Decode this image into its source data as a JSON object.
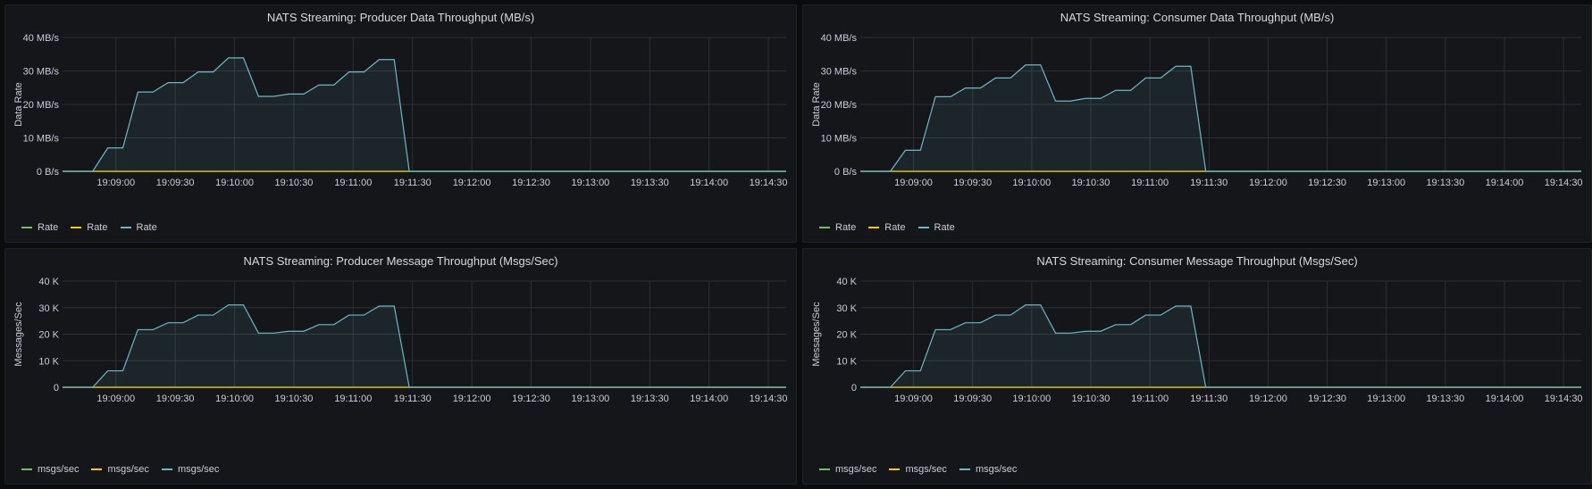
{
  "chart_data": [
    {
      "type": "line",
      "title": "NATS Streaming: Producer Data Throughput (MB/s)",
      "ylabel": "Data Rate",
      "ylim": [
        0,
        40
      ],
      "yticks": [
        0,
        10,
        20,
        30,
        40
      ],
      "ytick_labels": [
        "0 B/s",
        "10 MB/s",
        "20 MB/s",
        "30 MB/s",
        "40 MB/s"
      ],
      "xticks": [
        "19:09:00",
        "19:09:30",
        "19:10:00",
        "19:10:30",
        "19:11:00",
        "19:11:30",
        "19:12:00",
        "19:12:30",
        "19:13:00",
        "19:13:30",
        "19:14:00",
        "19:14:30"
      ],
      "xlim": [
        0,
        720
      ],
      "grid": true,
      "legend_position": "bottom-left",
      "series": [
        {
          "name": "Rate",
          "color": "#73bf69",
          "x": [
            0,
            720
          ],
          "values": [
            0,
            0
          ]
        },
        {
          "name": "Rate",
          "color": "#f2cc0c",
          "x": [
            0,
            720
          ],
          "values": [
            0,
            0
          ]
        },
        {
          "name": "Rate",
          "color": "#6cb8c4",
          "fill": true,
          "x": [
            0,
            15,
            30,
            45,
            60,
            75,
            90,
            105,
            120,
            135,
            150,
            165,
            180,
            195,
            210,
            225,
            240,
            255,
            270,
            285,
            300,
            315,
            330,
            345,
            360,
            375,
            390,
            405,
            420,
            435,
            450,
            465,
            480,
            495,
            510,
            525,
            540,
            555,
            570,
            585,
            600,
            615,
            630,
            645,
            660,
            675,
            690,
            705,
            720
          ],
          "values": [
            0,
            0,
            0,
            7,
            7,
            23.7,
            23.7,
            26.5,
            26.5,
            29.7,
            29.7,
            33.9,
            33.9,
            22.4,
            22.4,
            23.1,
            23.1,
            25.8,
            25.8,
            29.7,
            29.7,
            33.4,
            33.4,
            0,
            0,
            0,
            0,
            0,
            0,
            0,
            0,
            0,
            0,
            0,
            0,
            0,
            0,
            0,
            0,
            0,
            0,
            0,
            0,
            0,
            0,
            0,
            0,
            0,
            0
          ]
        }
      ]
    },
    {
      "type": "line",
      "title": "NATS Streaming: Consumer Data Throughput (MB/s)",
      "ylabel": "Data Rate",
      "ylim": [
        0,
        40
      ],
      "yticks": [
        0,
        10,
        20,
        30,
        40
      ],
      "ytick_labels": [
        "0 B/s",
        "10 MB/s",
        "20 MB/s",
        "30 MB/s",
        "40 MB/s"
      ],
      "xticks": [
        "19:09:00",
        "19:09:30",
        "19:10:00",
        "19:10:30",
        "19:11:00",
        "19:11:30",
        "19:12:00",
        "19:12:30",
        "19:13:00",
        "19:13:30",
        "19:14:00",
        "19:14:30"
      ],
      "xlim": [
        0,
        720
      ],
      "grid": true,
      "legend_position": "bottom-left",
      "series": [
        {
          "name": "Rate",
          "color": "#73bf69",
          "x": [
            0,
            720
          ],
          "values": [
            0,
            0
          ]
        },
        {
          "name": "Rate",
          "color": "#f2cc0c",
          "x": [
            0,
            720
          ],
          "values": [
            0,
            0
          ]
        },
        {
          "name": "Rate",
          "color": "#6cb8c4",
          "fill": true,
          "x": [
            0,
            15,
            30,
            45,
            60,
            75,
            90,
            105,
            120,
            135,
            150,
            165,
            180,
            195,
            210,
            225,
            240,
            255,
            270,
            285,
            300,
            315,
            330,
            345,
            360,
            375,
            390,
            405,
            420,
            435,
            450,
            465,
            480,
            495,
            510,
            525,
            540,
            555,
            570,
            585,
            600,
            615,
            630,
            645,
            660,
            675,
            690,
            705,
            720
          ],
          "values": [
            0,
            0,
            0,
            6.3,
            6.3,
            22.3,
            22.3,
            24.9,
            24.9,
            27.9,
            27.9,
            31.8,
            31.8,
            21,
            21,
            21.8,
            21.8,
            24.2,
            24.2,
            27.9,
            27.9,
            31.4,
            31.4,
            0,
            0,
            0,
            0,
            0,
            0,
            0,
            0,
            0,
            0,
            0,
            0,
            0,
            0,
            0,
            0,
            0,
            0,
            0,
            0,
            0,
            0,
            0,
            0,
            0,
            0
          ]
        }
      ]
    },
    {
      "type": "line",
      "title": "NATS Streaming: Producer Message Throughput (Msgs/Sec)",
      "ylabel": "Messages/Sec",
      "ylim": [
        0,
        40000
      ],
      "yticks": [
        0,
        10000,
        20000,
        30000,
        40000
      ],
      "ytick_labels": [
        "0",
        "10 K",
        "20 K",
        "30 K",
        "40 K"
      ],
      "xticks": [
        "19:09:00",
        "19:09:30",
        "19:10:00",
        "19:10:30",
        "19:11:00",
        "19:11:30",
        "19:12:00",
        "19:12:30",
        "19:13:00",
        "19:13:30",
        "19:14:00",
        "19:14:30"
      ],
      "xlim": [
        0,
        720
      ],
      "grid": true,
      "legend_position": "bottom-left",
      "series": [
        {
          "name": "msgs/sec",
          "color": "#73bf69",
          "x": [
            0,
            720
          ],
          "values": [
            0,
            0
          ]
        },
        {
          "name": "msgs/sec",
          "color": "#f2cc0c",
          "x": [
            0,
            720
          ],
          "values": [
            0,
            0
          ]
        },
        {
          "name": "msgs/sec",
          "color": "#6cb8c4",
          "fill": true,
          "x": [
            0,
            15,
            30,
            45,
            60,
            75,
            90,
            105,
            120,
            135,
            150,
            165,
            180,
            195,
            210,
            225,
            240,
            255,
            270,
            285,
            300,
            315,
            330,
            345,
            360,
            375,
            390,
            405,
            420,
            435,
            450,
            465,
            480,
            495,
            510,
            525,
            540,
            555,
            570,
            585,
            600,
            615,
            630,
            645,
            660,
            675,
            690,
            705,
            720
          ],
          "values": [
            0,
            0,
            0,
            6200,
            6200,
            21700,
            21700,
            24300,
            24300,
            27200,
            27200,
            31000,
            31000,
            20400,
            20400,
            21100,
            21100,
            23600,
            23600,
            27200,
            27200,
            30600,
            30600,
            0,
            0,
            0,
            0,
            0,
            0,
            0,
            0,
            0,
            0,
            0,
            0,
            0,
            0,
            0,
            0,
            0,
            0,
            0,
            0,
            0,
            0,
            0,
            0,
            0,
            0
          ]
        }
      ]
    },
    {
      "type": "line",
      "title": "NATS Streaming: Consumer Message Throughput (Msgs/Sec)",
      "ylabel": "Messages/Sec",
      "ylim": [
        0,
        40000
      ],
      "yticks": [
        0,
        10000,
        20000,
        30000,
        40000
      ],
      "ytick_labels": [
        "0",
        "10 K",
        "20 K",
        "30 K",
        "40 K"
      ],
      "xticks": [
        "19:09:00",
        "19:09:30",
        "19:10:00",
        "19:10:30",
        "19:11:00",
        "19:11:30",
        "19:12:00",
        "19:12:30",
        "19:13:00",
        "19:13:30",
        "19:14:00",
        "19:14:30"
      ],
      "xlim": [
        0,
        720
      ],
      "grid": true,
      "legend_position": "bottom-left",
      "series": [
        {
          "name": "msgs/sec",
          "color": "#73bf69",
          "x": [
            0,
            720
          ],
          "values": [
            0,
            0
          ]
        },
        {
          "name": "msgs/sec",
          "color": "#f2cc0c",
          "x": [
            0,
            720
          ],
          "values": [
            0,
            0
          ]
        },
        {
          "name": "msgs/sec",
          "color": "#6cb8c4",
          "fill": true,
          "x": [
            0,
            15,
            30,
            45,
            60,
            75,
            90,
            105,
            120,
            135,
            150,
            165,
            180,
            195,
            210,
            225,
            240,
            255,
            270,
            285,
            300,
            315,
            330,
            345,
            360,
            375,
            390,
            405,
            420,
            435,
            450,
            465,
            480,
            495,
            510,
            525,
            540,
            555,
            570,
            585,
            600,
            615,
            630,
            645,
            660,
            675,
            690,
            705,
            720
          ],
          "values": [
            0,
            0,
            0,
            6200,
            6200,
            21700,
            21700,
            24300,
            24300,
            27200,
            27200,
            31000,
            31000,
            20400,
            20400,
            21100,
            21100,
            23600,
            23600,
            27200,
            27200,
            30600,
            30600,
            0,
            0,
            0,
            0,
            0,
            0,
            0,
            0,
            0,
            0,
            0,
            0,
            0,
            0,
            0,
            0,
            0,
            0,
            0,
            0,
            0,
            0,
            0,
            0,
            0,
            0
          ]
        }
      ]
    }
  ]
}
